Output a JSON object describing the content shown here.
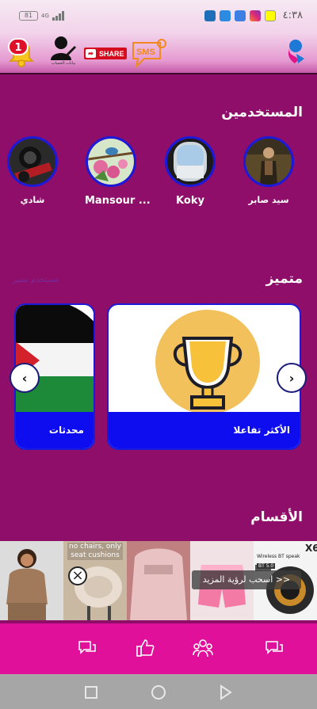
{
  "status_bar": {
    "battery": "81",
    "network": "4G",
    "time": "٤:٣٨"
  },
  "top_bar": {
    "notification_count": "1",
    "user_caption": "بيانات الحساب",
    "share_label": "SHARE",
    "sms_label": "SMS"
  },
  "users_section": {
    "title": "المستخدمين",
    "users": [
      {
        "name": "سيد صابر"
      },
      {
        "name": "Koky"
      },
      {
        "name": "Mansour ..."
      },
      {
        "name": "شادي"
      }
    ]
  },
  "featured_section": {
    "title": "متميز",
    "faded_label": "مستخدم مميز",
    "cards": [
      {
        "label": "الأكثر تفاعلا"
      },
      {
        "label": "محدثات"
      }
    ]
  },
  "categories_section": {
    "title": "الأقسام"
  },
  "ad": {
    "top_text": "no chairs, only seat cushions",
    "swipe_text": "اسحب لرؤية المزيد >>",
    "brand_text": "X6",
    "speaker_text": "Wireless BT speak",
    "mini_label": "BT 5.0"
  },
  "bottom_nav": {
    "items": [
      "chat-icon",
      "like-icon",
      "group-icon",
      "comments-icon"
    ]
  },
  "colors": {
    "background": "#8e0e6a",
    "accent_blue": "#0d0df0",
    "bottom_nav": "#e1109a"
  }
}
